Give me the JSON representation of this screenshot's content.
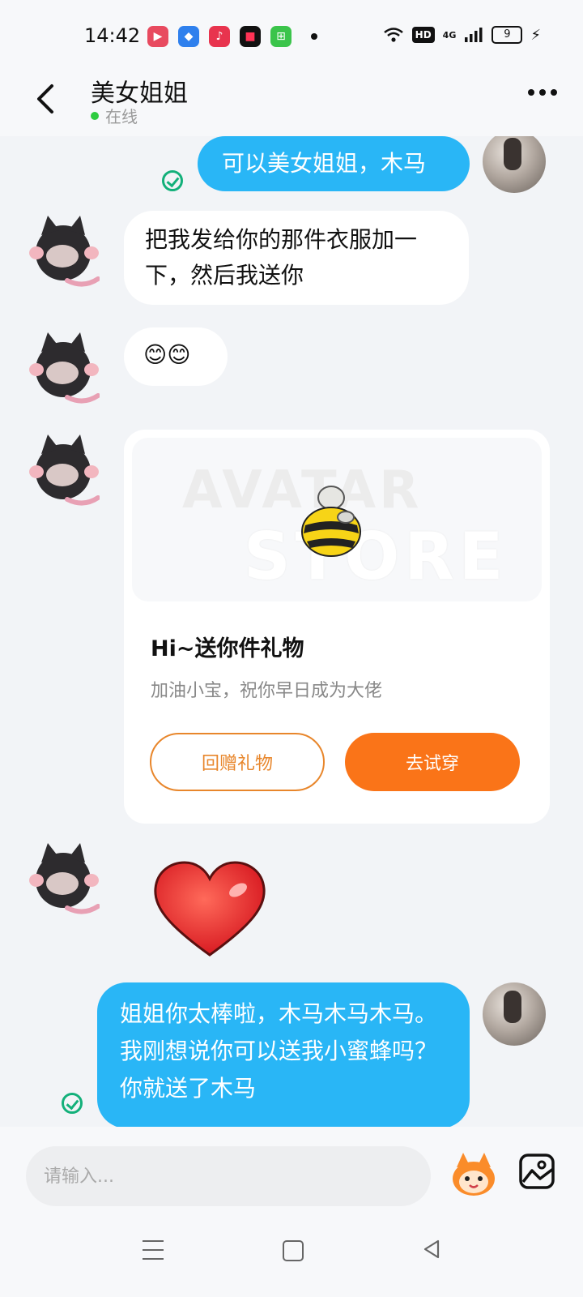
{
  "status_bar": {
    "time": "14:42",
    "network": "4G",
    "hd": "HD",
    "battery": "9",
    "app_icons": [
      "video-app-icon",
      "browser-app-icon",
      "music-app-icon",
      "camera-app-icon",
      "calculator-app-icon"
    ]
  },
  "header": {
    "title": "美女姐姐",
    "status": "在线",
    "status_color": "#2ecc40"
  },
  "messages": [
    {
      "from": "me",
      "type": "text",
      "text": "可以美女姐姐，木马",
      "read": true
    },
    {
      "from": "other",
      "type": "text",
      "text": "把我发给你的那件衣服加一下，然后我送你"
    },
    {
      "from": "other",
      "type": "emoji",
      "text": "😊😊"
    },
    {
      "from": "other",
      "type": "gift_card"
    },
    {
      "from": "other",
      "type": "sticker",
      "sticker": "heart-sticker"
    },
    {
      "from": "me",
      "type": "text",
      "text": "姐姐你太棒啦，木马木马木马。我刚想说你可以送我小蜜蜂吗？你就送了木马",
      "read": true
    }
  ],
  "gift_card": {
    "watermark_line1": "AVATAR",
    "watermark_line2": "STORE",
    "title": "Hi~送你件礼物",
    "subtitle": "加油小宝，祝你早日成为大佬",
    "return_button": "回赠礼物",
    "try_button": "去试穿",
    "accent_color": "#fa7418"
  },
  "input_bar": {
    "placeholder": "请输入..."
  },
  "colors": {
    "my_bubble": "#29b6f6",
    "background": "#f2f4f7",
    "read_check": "#13b07a"
  }
}
